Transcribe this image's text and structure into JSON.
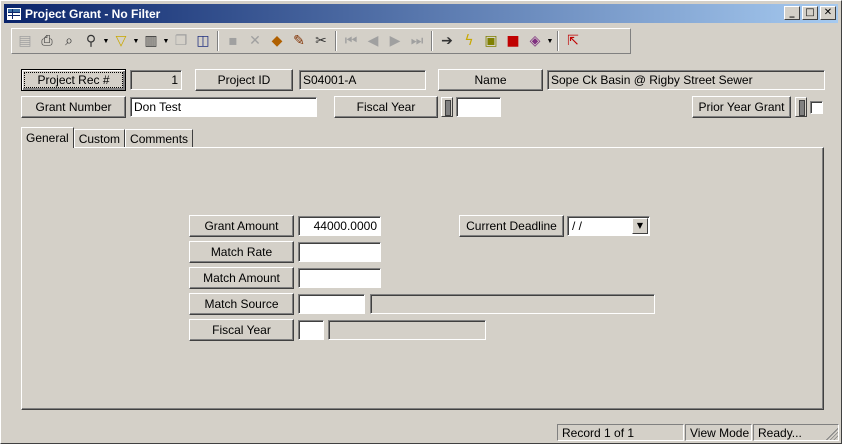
{
  "window": {
    "title": "Project Grant - No Filter"
  },
  "title_buttons": {
    "minimize": "_",
    "maximize": "□",
    "close": "✕"
  },
  "toolbar": {
    "icons": [
      "new-record-icon",
      "print-icon",
      "preview-icon",
      "find-icon",
      "filter-icon",
      "report-icon",
      "copy-icon",
      "export-icon",
      "save-icon",
      "delete-icon",
      "attach-icon",
      "edit-icon",
      "cut-icon",
      "first-record-icon",
      "prev-record-icon",
      "next-record-icon",
      "last-record-icon",
      "goto-icon",
      "run-icon",
      "map-icon",
      "tools-icon",
      "book-icon",
      "exit-icon"
    ]
  },
  "header": {
    "project_rec_label": "Project Rec #",
    "project_rec_value": "1",
    "project_id_label": "Project ID",
    "project_id_value": "S04001-A",
    "name_label": "Name",
    "name_value": "Sope Ck Basin @ Rigby Street Sewer",
    "grant_number_label": "Grant Number",
    "grant_number_value": "Don Test",
    "fiscal_year_label": "Fiscal Year",
    "fiscal_year_value": "",
    "prior_year_grant_label": "Prior Year Grant"
  },
  "tabs": [
    {
      "label": "General",
      "active": true
    },
    {
      "label": "Custom",
      "active": false
    },
    {
      "label": "Comments",
      "active": false
    }
  ],
  "general": {
    "grant_amount_label": "Grant Amount",
    "grant_amount_value": "44000.0000",
    "match_rate_label": "Match Rate",
    "match_rate_value": "",
    "match_amount_label": "Match Amount",
    "match_amount_value": "",
    "match_source_label": "Match Source",
    "match_source_value": "",
    "match_source_desc": "",
    "fiscal_year_label": "Fiscal Year",
    "fiscal_year_value": "",
    "fiscal_year_desc": "",
    "current_deadline_label": "Current Deadline",
    "current_deadline_value": " /  /"
  },
  "status": {
    "record": "Record 1 of 1",
    "mode": "View Mode",
    "state": "Ready..."
  },
  "colors": {
    "face": "#d4d0c8",
    "title_start": "#0a246a",
    "title_end": "#a6caf0"
  }
}
